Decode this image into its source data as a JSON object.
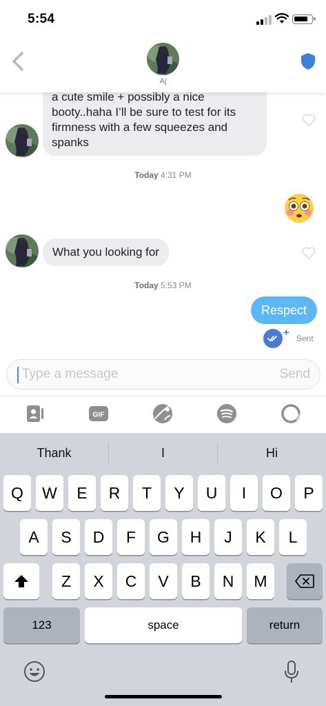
{
  "status": {
    "time": "5:54"
  },
  "header": {
    "contact_name": "Aj"
  },
  "messages": {
    "incoming_1": "a cute smile + possibly a nice booty..haha I’ll be sure to test for its firmness with a few squeezes and spanks",
    "timestamp_1": {
      "day": "Today",
      "time": "4:31 PM"
    },
    "outgoing_emoji": "flushed-face-emoji",
    "incoming_2": "What you looking for",
    "timestamp_2": {
      "day": "Today",
      "time": "5:53 PM"
    },
    "outgoing_1": "Respect",
    "sent_status": "Sent",
    "read_plus": "+"
  },
  "composer": {
    "placeholder": "Type a message",
    "send_label": "Send"
  },
  "toolbar": [
    "contact-card-icon",
    "gif-icon",
    "sticker-icon",
    "spotify-icon",
    "loop-icon"
  ],
  "toolbar_labels": {
    "gif": "GIF"
  },
  "keyboard": {
    "suggestions": [
      "Thank",
      "I",
      "Hi"
    ],
    "row1": [
      "Q",
      "W",
      "E",
      "R",
      "T",
      "Y",
      "U",
      "I",
      "O",
      "P"
    ],
    "row2": [
      "A",
      "S",
      "D",
      "F",
      "G",
      "H",
      "J",
      "K",
      "L"
    ],
    "row3": [
      "Z",
      "X",
      "C",
      "V",
      "B",
      "N",
      "M"
    ],
    "numbers_label": "123",
    "space_label": "space",
    "return_label": "return"
  },
  "colors": {
    "accent_blue": "#5cb8f5",
    "shield_blue": "#3e7fd9",
    "read_blue": "#4a7ad4"
  }
}
